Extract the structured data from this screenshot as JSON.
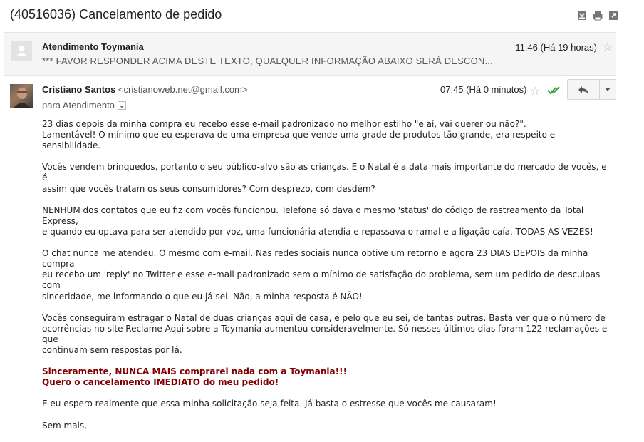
{
  "thread": {
    "subject": "(40516036) Cancelamento de pedido",
    "icons": [
      "expand-all-icon",
      "print-icon",
      "new-window-icon"
    ]
  },
  "collapsed_message": {
    "sender": "Atendimento Toymania",
    "snippet": "*** FAVOR RESPONDER ACIMA DESTE TEXTO, QUALQUER INFORMAÇÃO ABAIXO SERÁ DESCON...",
    "time": "11:46 (Há 19 horas)"
  },
  "open_message": {
    "sender_name": "Cristiano Santos",
    "sender_email": "<cristianoweb.net@gmail.com>",
    "to": "para Atendimento",
    "time": "07:45 (Há 0 minutos)",
    "paragraphs": [
      {
        "lines": [
          "23 dias depois da minha compra eu recebo esse e-mail padronizado no melhor estilho \"e aí, vai querer ou não?\".",
          "Lamentável! O mínimo que eu esperava de uma empresa que vende uma grade de produtos tão grande, era respeito e sensibilidade."
        ]
      },
      {
        "lines": [
          "Vocês vendem brinquedos, portanto o seu público-alvo são as crianças. E o Natal é a data mais importante do mercado de vocês, e é",
          "assim que vocês tratam os seus consumidores? Com desprezo, com desdém?"
        ]
      },
      {
        "lines": [
          "NENHUM dos contatos que eu fiz com vocês funcionou. Telefone só dava o mesmo 'status' do código de rastreamento da Total Express,",
          "e quando eu optava para ser atendido por voz, uma funcionária atendia e repassava o ramal e a ligação caía. TODAS AS VEZES!"
        ]
      },
      {
        "lines": [
          "O chat nunca me atendeu. O mesmo com e-mail. Nas redes sociais nunca obtive um retorno e agora 23 DIAS DEPOIS da minha compra",
          "eu recebo um 'reply' no Twitter e esse e-mail padronizado sem o mínimo de satisfação do problema, sem um pedido de desculpas com",
          "sinceridade, me informando o que eu já sei. Não, a minha resposta é NÃO!"
        ]
      },
      {
        "lines": [
          "Vocês conseguiram estragar o Natal de duas crianças aqui de casa, e pelo que eu sei, de tantas outras. Basta ver que o número de",
          "ocorrências no site Reclame Aqui sobre a Toymania aumentou consideravelmente. Só nesses últimos dias foram 122 reclamações e que",
          "continuam sem respostas por lá."
        ]
      },
      {
        "red": true,
        "lines": [
          "Sinceramente, NUNCA MAIS comprarei nada com a Toymania!!!",
          "Quero o cancelamento IMEDIATO do meu pedido!"
        ]
      },
      {
        "lines": [
          "E eu espero realmente que essa minha solicitação seja feita. Já basta o estresse que vocês me causaram!"
        ]
      },
      {
        "lines": [
          "Sem mais,"
        ]
      }
    ]
  }
}
